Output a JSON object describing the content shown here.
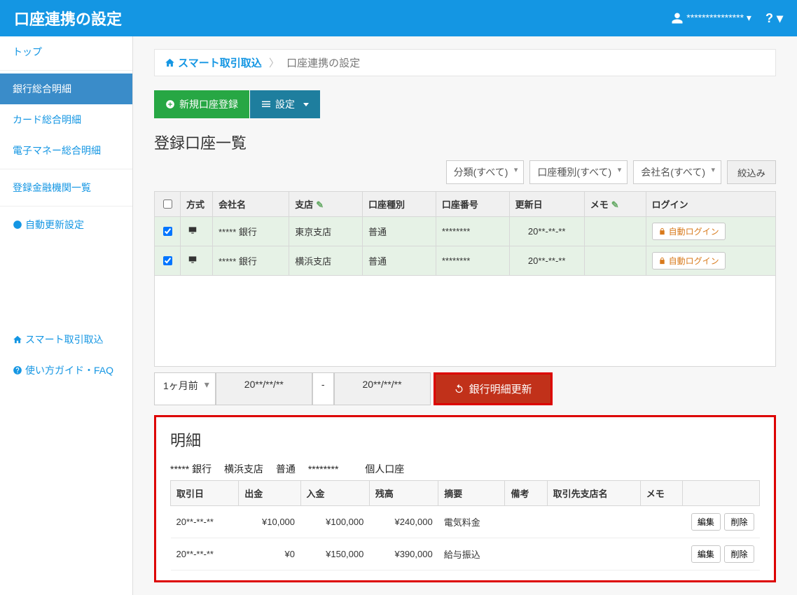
{
  "topbar": {
    "title": "口座連携の設定",
    "username": "***************",
    "help": "?"
  },
  "sidebar": {
    "top": "トップ",
    "items": [
      "銀行総合明細",
      "カード総合明細",
      "電子マネー総合明細"
    ],
    "reg_list": "登録金融機関一覧",
    "auto_update": "自動更新設定",
    "smart": "スマート取引取込",
    "faq": "使い方ガイド・FAQ"
  },
  "breadcrumb": {
    "home": "スマート取引取込",
    "current": "口座連携の設定"
  },
  "toolbar": {
    "new_acct": "新規口座登録",
    "settings": "設定"
  },
  "section_title": "登録口座一覧",
  "filters": {
    "category": "分類(すべて)",
    "acct_type": "口座種別(すべて)",
    "company": "会社名(すべて)",
    "filter_btn": "絞込み"
  },
  "accounts_table": {
    "headers": {
      "method": "方式",
      "company": "会社名",
      "branch": "支店",
      "type": "口座種別",
      "number": "口座番号",
      "updated": "更新日",
      "memo": "メモ",
      "login": "ログイン"
    },
    "rows": [
      {
        "company": "***** 銀行",
        "branch": "東京支店",
        "type": "普通",
        "number": "********",
        "updated": "20**-**-**",
        "login": "自動ログイン"
      },
      {
        "company": "***** 銀行",
        "branch": "横浜支店",
        "type": "普通",
        "number": "********",
        "updated": "20**-**-**",
        "login": "自動ログイン"
      }
    ]
  },
  "date_range": {
    "period": "1ヶ月前",
    "from": "20**/**/**",
    "dash": "-",
    "to": "20**/**/**",
    "update_btn": "銀行明細更新"
  },
  "detail": {
    "title": "明細",
    "account": {
      "bank": "***** 銀行",
      "branch": "横浜支店",
      "type": "普通",
      "number": "********",
      "kind": "個人口座"
    },
    "headers": {
      "date": "取引日",
      "out": "出金",
      "in": "入金",
      "balance": "残高",
      "desc": "摘要",
      "note": "備考",
      "partner": "取引先支店名",
      "memo": "メモ"
    },
    "rows": [
      {
        "date": "20**-**-**",
        "out": "¥10,000",
        "in": "¥100,000",
        "balance": "¥240,000",
        "desc": "電気料金"
      },
      {
        "date": "20**-**-**",
        "out": "¥0",
        "in": "¥150,000",
        "balance": "¥390,000",
        "desc": "給与振込"
      }
    ],
    "edit": "編集",
    "del": "削除"
  }
}
